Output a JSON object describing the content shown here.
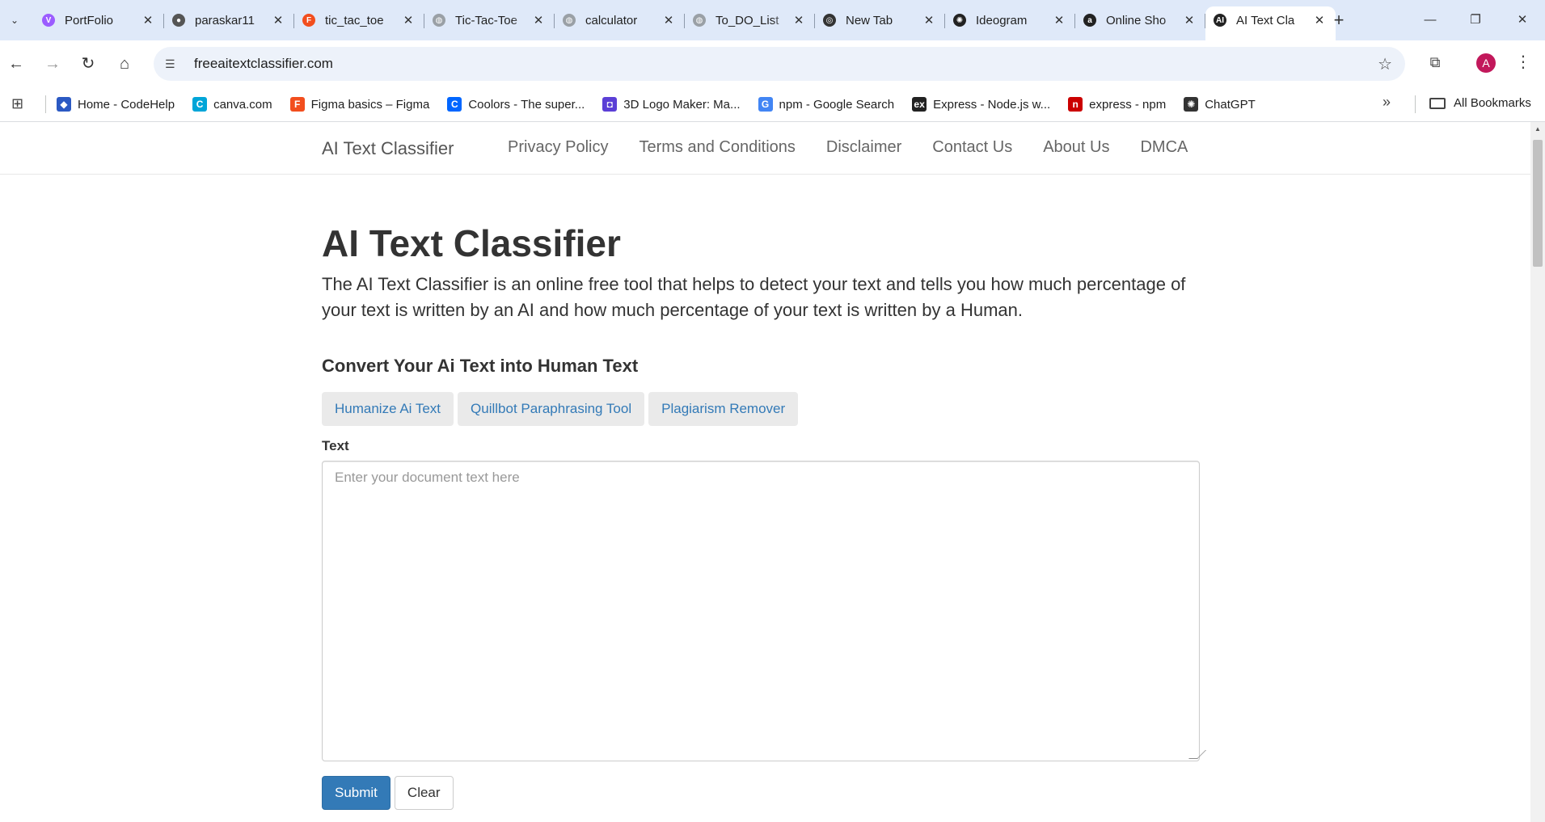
{
  "browser": {
    "tabs": [
      {
        "title": "PortFolio",
        "icon": "vite-icon",
        "color": "#9b5cff",
        "glyph": "V"
      },
      {
        "title": "paraskar11",
        "icon": "github-icon",
        "color": "#555555",
        "glyph": "●"
      },
      {
        "title": "tic_tac_toe",
        "icon": "figma-icon",
        "color": "#f24e1e",
        "glyph": "F"
      },
      {
        "title": "Tic-Tac-Toe",
        "icon": "globe-icon",
        "color": "#9aa0a6",
        "glyph": "◍"
      },
      {
        "title": "calculator",
        "icon": "globe-icon",
        "color": "#9aa0a6",
        "glyph": "◍"
      },
      {
        "title": "To_DO_List",
        "icon": "globe-icon",
        "color": "#9aa0a6",
        "glyph": "◍"
      },
      {
        "title": "New Tab",
        "icon": "chrome-icon",
        "color": "#333333",
        "glyph": "◎"
      },
      {
        "title": "Ideogram",
        "icon": "ideogram-icon",
        "color": "#222222",
        "glyph": "✺"
      },
      {
        "title": "Online Sho",
        "icon": "amazon-icon",
        "color": "#222222",
        "glyph": "a"
      },
      {
        "title": "AI Text Cla",
        "icon": "ai-icon",
        "color": "#222222",
        "glyph": "AI",
        "active": true
      }
    ],
    "url": "freeaitextclassifier.com",
    "profile_initial": "A",
    "bookmarks": [
      {
        "label": "Home - CodeHelp",
        "icon": "codehelp-icon",
        "color": "#2b59c3",
        "glyph": "◆"
      },
      {
        "label": "canva.com",
        "icon": "canva-icon",
        "color": "#00a5d8",
        "glyph": "C"
      },
      {
        "label": "Figma basics – Figma",
        "icon": "figma-icon",
        "color": "#f24e1e",
        "glyph": "F"
      },
      {
        "label": "Coolors - The super...",
        "icon": "coolors-icon",
        "color": "#0066ff",
        "glyph": "C"
      },
      {
        "label": "3D Logo Maker: Ma...",
        "icon": "logomaker-icon",
        "color": "#5b3fd6",
        "glyph": "◘"
      },
      {
        "label": "npm - Google Search",
        "icon": "google-icon",
        "color": "#4285f4",
        "glyph": "G"
      },
      {
        "label": "Express - Node.js w...",
        "icon": "express-icon",
        "color": "#222222",
        "glyph": "ex"
      },
      {
        "label": "express - npm",
        "icon": "npm-icon",
        "color": "#cb0000",
        "glyph": "n"
      },
      {
        "label": "ChatGPT",
        "icon": "chatgpt-icon",
        "color": "#333333",
        "glyph": "✺"
      }
    ],
    "all_bookmarks": "All Bookmarks"
  },
  "site": {
    "brand": "AI Text Classifier",
    "nav": [
      "Privacy Policy",
      "Terms and Conditions",
      "Disclaimer",
      "Contact Us",
      "About Us",
      "DMCA"
    ],
    "title": "AI Text Classifier",
    "description": "The AI Text Classifier is an online free tool that helps to detect your text and tells you how much percentage of your text is written by an AI and how much percentage of your text is written by a Human.",
    "convert_heading": "Convert Your Ai Text into Human Text",
    "tools": [
      "Humanize Ai Text",
      "Quillbot Paraphrasing Tool",
      "Plagiarism Remover"
    ],
    "text_label": "Text",
    "text_placeholder": "Enter your document text here",
    "submit": "Submit",
    "clear": "Clear"
  },
  "colors": {
    "tabstrip": "#dfe9f9",
    "primary": "#337ab7",
    "avatar": "#c2185b"
  }
}
